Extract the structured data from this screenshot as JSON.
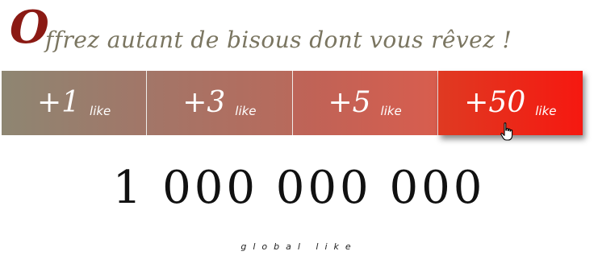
{
  "headline": {
    "drop_cap": "O",
    "rest": "ffrez autant de bisous dont vous rêvez !"
  },
  "like_buttons": [
    {
      "amount": "+1",
      "unit": "like"
    },
    {
      "amount": "+3",
      "unit": "like"
    },
    {
      "amount": "+5",
      "unit": "like"
    },
    {
      "amount": "+50",
      "unit": "like"
    }
  ],
  "counter": {
    "value": "1 000 000 000",
    "caption": "global like"
  },
  "colors": {
    "drop_cap": "#8b1a14",
    "headline_text": "#7a7560",
    "hovered_button": "#f61810"
  },
  "cursor": {
    "icon": "hand-pointer-icon"
  }
}
